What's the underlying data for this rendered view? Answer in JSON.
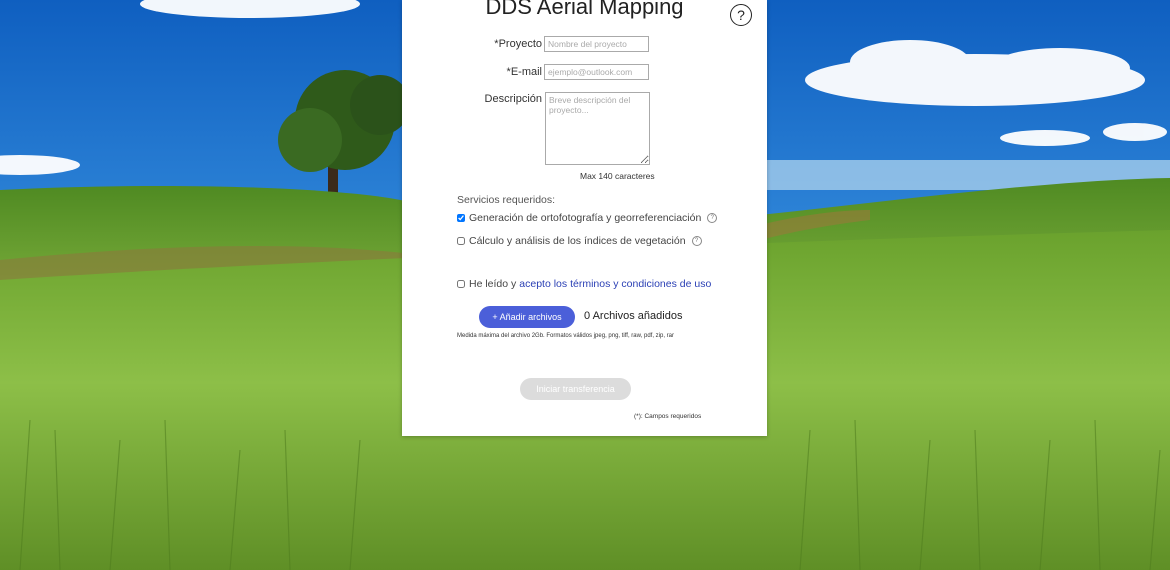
{
  "app": {
    "title": "DDS Aerial Mapping",
    "help_glyph": "?"
  },
  "form": {
    "project": {
      "label": "*Proyecto",
      "placeholder": "Nombre del proyecto",
      "value": ""
    },
    "email": {
      "label": "*E-mail",
      "placeholder": "ejemplo@outlook.com",
      "value": ""
    },
    "description": {
      "label": "Descripción",
      "placeholder": "Breve descripción del proyecto...",
      "value": "",
      "max_hint": "Max 140 caracteres"
    },
    "services": {
      "heading": "Servicios requeridos:",
      "items": [
        {
          "label": "Generación de ortofotografía y georreferenciación",
          "checked": true
        },
        {
          "label": "Cálculo y análisis de los índices de vegetación",
          "checked": false
        }
      ]
    },
    "terms": {
      "prefix": "He leído y",
      "link": "acepto los términos y condiciones de uso",
      "checked": false
    },
    "upload": {
      "button_label": "+ Añadir archivos",
      "count_label": "0 Archivos añadidos",
      "size_note": "Medida máxima del archivo 2Gb. Formatos válidos jpeg, png, tiff, raw, pdf, zip, rar"
    },
    "submit": {
      "label": "Iniciar transferencia",
      "enabled": false
    },
    "required_note": "(*): Campos requeridos"
  },
  "colors": {
    "accent": "#4b5fd9",
    "link": "#2a3fb4",
    "disabled": "#dcdcdc",
    "sky": "#1f7fd6",
    "field_green": "#7fb03a"
  },
  "icons": {
    "help": "question-circle-icon",
    "mini_help": "question-circle-small-icon",
    "checkbox": "checkbox-icon"
  }
}
